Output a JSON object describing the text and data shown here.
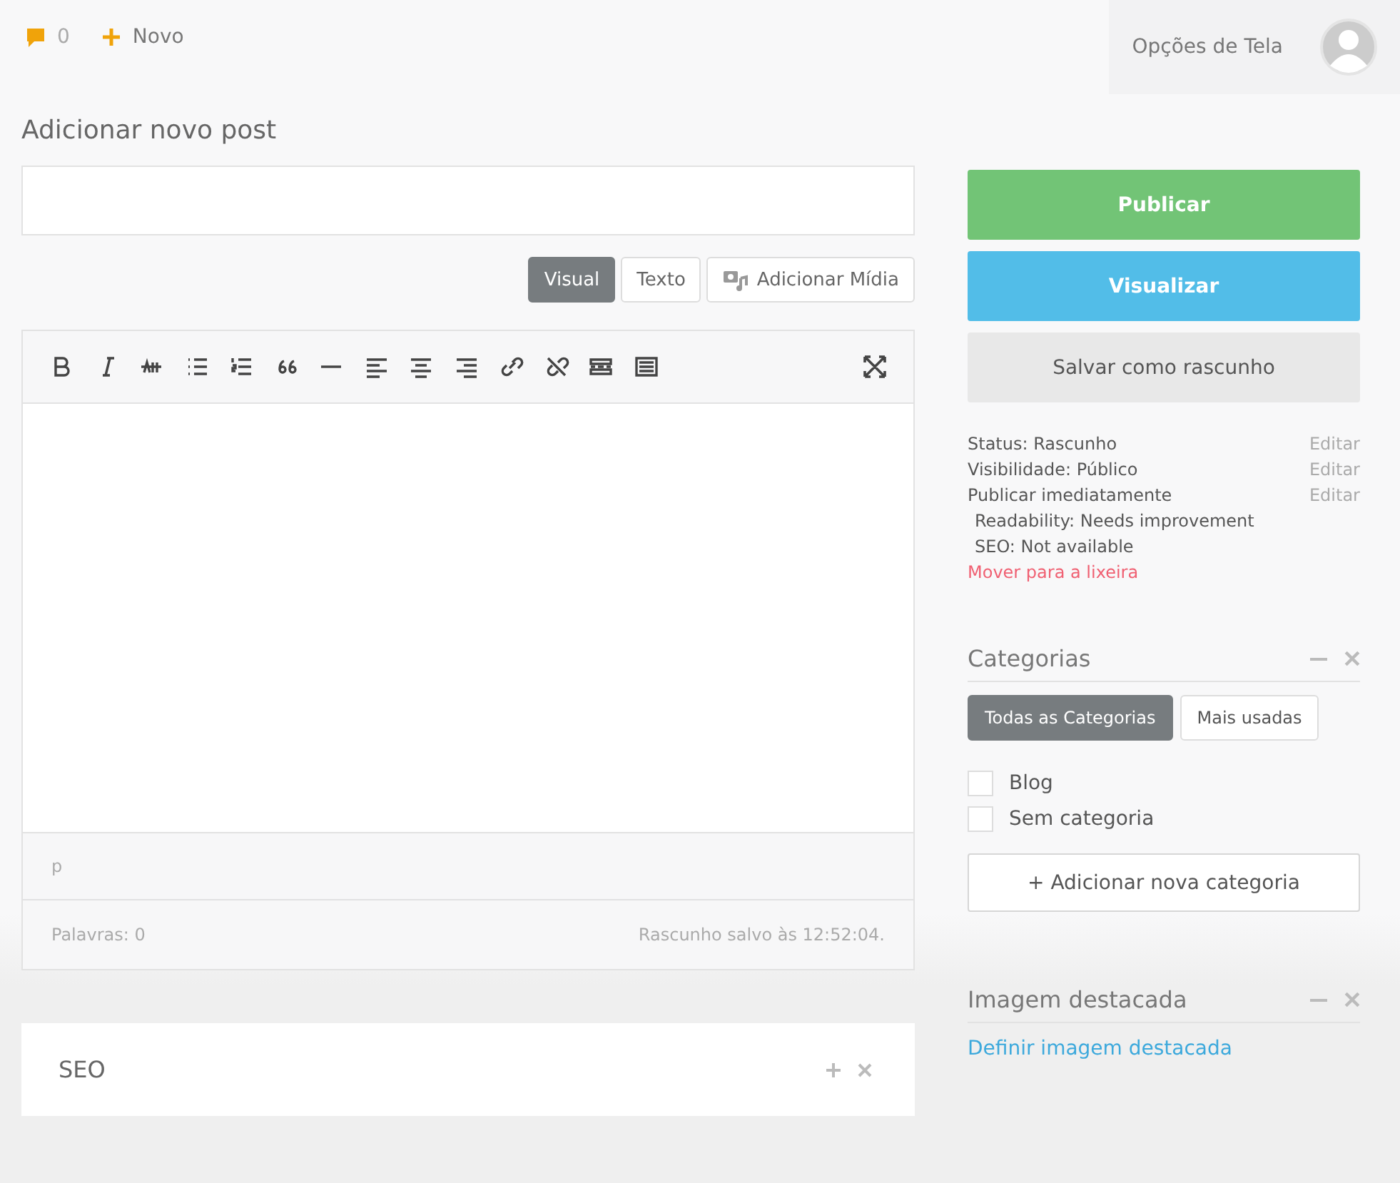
{
  "top_bar": {
    "comments_count": "0",
    "new_label": "Novo",
    "screen_options": "Opções de Tela"
  },
  "page_title": "Adicionar novo post",
  "editor": {
    "tabs": [
      {
        "label": "Visual",
        "selected": true
      },
      {
        "label": "Texto",
        "selected": false
      }
    ],
    "add_media": "Adicionar Mídia",
    "path": "p",
    "word_count": "Palavras: 0",
    "draft_saved": "Rascunho salvo às 12:52:04."
  },
  "seo_box": {
    "title": "SEO"
  },
  "publish": {
    "buttons": [
      {
        "label": "Publicar",
        "kind": "publish"
      },
      {
        "label": "Visualizar",
        "kind": "preview"
      },
      {
        "label": "Salvar como rascunho",
        "kind": "draft"
      }
    ],
    "info": [
      {
        "text": "Status: Rascunho",
        "action": "Editar",
        "kind": "line"
      },
      {
        "text": "Visibilidade: Público",
        "action": "Editar",
        "kind": "line"
      },
      {
        "text": "Publicar imediatamente",
        "action": "Editar",
        "kind": "line"
      },
      {
        "text": "Readability: Needs improvement",
        "kind": "score"
      },
      {
        "text": "SEO: Not available",
        "kind": "score"
      }
    ],
    "trash": "Mover para a lixeira"
  },
  "categories": {
    "title": "Categorias",
    "tabs": [
      {
        "label": "Todas as Categorias",
        "selected": true
      },
      {
        "label": "Mais usadas",
        "selected": false
      }
    ],
    "items": [
      {
        "label": "Blog",
        "checked": false
      },
      {
        "label": "Sem categoria",
        "checked": false
      }
    ],
    "add_button": "+ Adicionar nova categoria"
  },
  "featured_image": {
    "title": "Imagem destacada",
    "link": "Definir imagem destacada"
  }
}
